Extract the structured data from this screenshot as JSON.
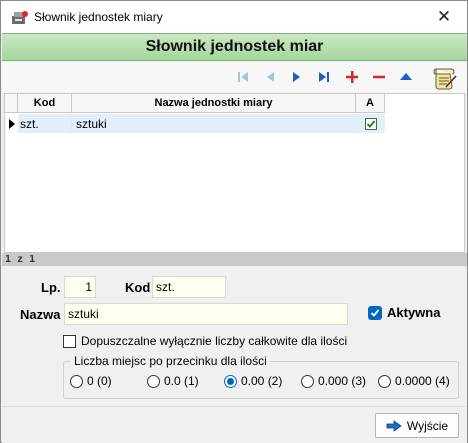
{
  "window": {
    "title": "Słownik jednostek miary",
    "close_glyph": "✕"
  },
  "header": {
    "title": "Słownik jednostek miar"
  },
  "toolbar": {
    "icons": [
      "first-icon",
      "prior-icon",
      "next-icon",
      "last-icon",
      "plus-icon",
      "minus-icon",
      "up-icon",
      "scroll-icon"
    ]
  },
  "grid": {
    "columns": [
      "Kod",
      "Nazwa jednostki miary",
      "A"
    ],
    "rows": [
      {
        "kod": "szt.",
        "nazwa": "sztuki",
        "aktywna": true
      }
    ]
  },
  "status": {
    "text": "1 z 1"
  },
  "form": {
    "lp_label": "Lp.",
    "lp_value": "1",
    "kod_label": "Kod",
    "kod_value": "szt.",
    "nazwa_label": "Nazwa",
    "nazwa_value": "sztuki",
    "aktywna_label": "Aktywna",
    "aktywna_checked": true,
    "integers_label": "Dopuszczalne wyłącznie liczby całkowite dla ilości",
    "integers_checked": false,
    "decimals_group_label": "Liczba miejsc po przecinku dla ilości",
    "decimals_options": [
      "0 (0)",
      "0.0 (1)",
      "0.00 (2)",
      "0.000 (3)",
      "0.0000 (4)"
    ],
    "decimals_selected": "0.00 (2)"
  },
  "footer": {
    "exit_label": "Wyjście"
  },
  "colors": {
    "header_green": "#a4d69b",
    "nav_blue": "#1f5fbf",
    "add_red": "#d9262b",
    "accent_blue": "#0067c0"
  }
}
